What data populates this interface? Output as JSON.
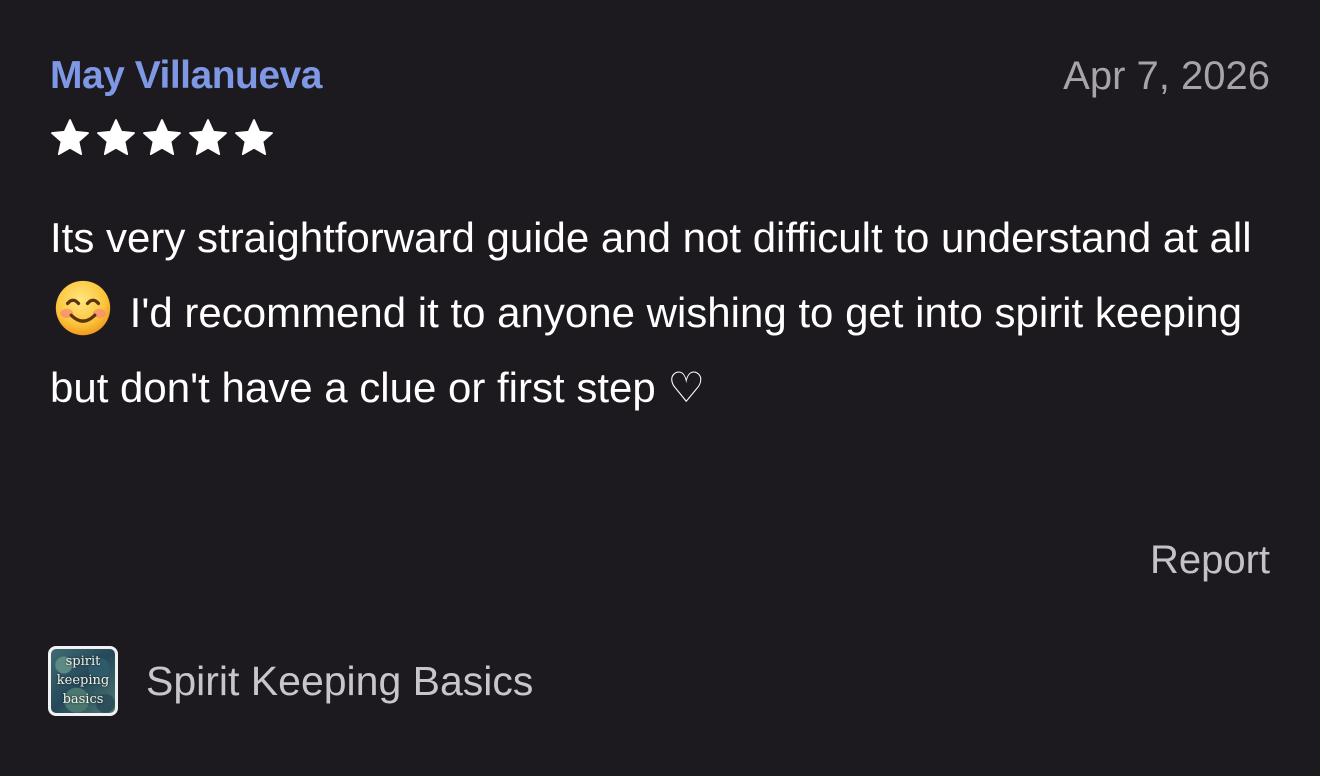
{
  "review": {
    "reviewer_name": "May Villanueva",
    "date": "Apr 7, 2026",
    "rating": 5,
    "rating_max": 5,
    "body_parts": {
      "before_emoji": "Its very straightforward guide and not difficult to understand at all",
      "emoji": "smiling-face-emoji",
      "after_emoji": "I'd recommend it to anyone wishing to get into spirit keeping but don't have a clue or first step ♡"
    },
    "report_label": "Report"
  },
  "book": {
    "title": "Spirit Keeping Basics",
    "cover_lines": [
      "spirit",
      "keeping",
      "basics"
    ],
    "cover_icon": "book-cover-image"
  },
  "colors": {
    "background": "#1c1a1e",
    "reviewer_name": "#7e98e6",
    "date": "#a6a3ab",
    "body_text": "#ffffff",
    "stars": "#ffffff",
    "report": "#c4c1c8",
    "book_title": "#c8c5cc"
  }
}
